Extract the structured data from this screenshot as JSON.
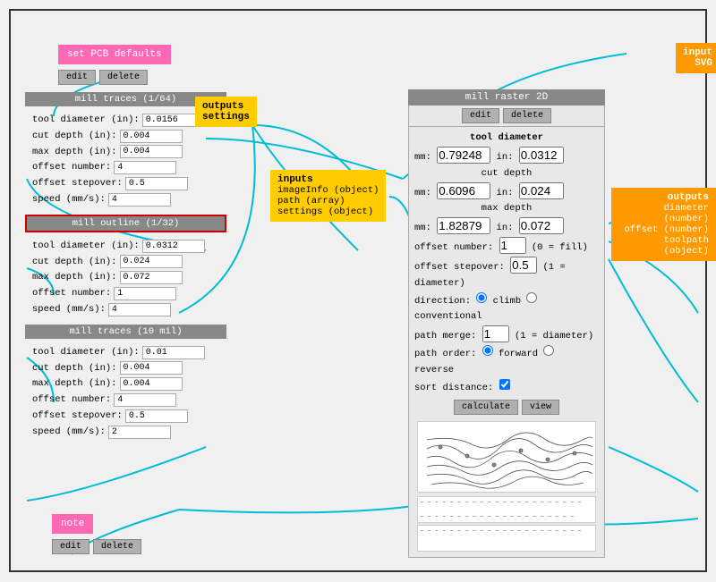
{
  "frame": {
    "border_color": "#333"
  },
  "nodes": {
    "set_pcb_defaults": {
      "label": "set PCB defaults"
    },
    "edit_delete_1": {
      "edit": "edit",
      "delete": "delete"
    },
    "mill_traces_164": {
      "title": "mill traces (1/64)",
      "tool_diameter_label": "tool diameter (in):",
      "tool_diameter_val": "0.0156",
      "cut_depth_label": "cut depth (in):",
      "cut_depth_val": "0.004",
      "max_depth_label": "max depth (in):",
      "max_depth_val": "0.004",
      "offset_number_label": "offset number:",
      "offset_number_val": "4",
      "offset_stepover_label": "offset stepover:",
      "offset_stepover_val": "0.5",
      "speed_label": "speed (mm/s):",
      "speed_val": "4"
    },
    "mill_outline_132": {
      "title": "mill outline (1/32)",
      "tool_diameter_label": "tool diameter (in):",
      "tool_diameter_val": "0.0312",
      "cut_depth_label": "cut depth (in):",
      "cut_depth_val": "0.024",
      "max_depth_label": "max depth (in):",
      "max_depth_val": "0.072",
      "offset_number_label": "offset number:",
      "offset_number_val": "1",
      "speed_label": "speed (mm/s):",
      "speed_val": "4"
    },
    "mill_traces_10mil": {
      "title": "mill traces (10 mil)",
      "tool_diameter_label": "tool diameter (in):",
      "tool_diameter_val": "0.01",
      "cut_depth_label": "cut depth (in):",
      "cut_depth_val": "0.004",
      "max_depth_label": "max depth (in):",
      "max_depth_val": "0.004",
      "offset_number_label": "offset number:",
      "offset_number_val": "4",
      "offset_stepover_label": "offset stepover:",
      "offset_stepover_val": "0.5",
      "speed_label": "speed (mm/s):",
      "speed_val": "2"
    },
    "outputs_settings": {
      "label": "outputs\nsettings"
    },
    "inputs_node": {
      "label": "inputs",
      "items": [
        "imageInfo (object)",
        "path (array)",
        "settings (object)"
      ]
    },
    "mill_raster_2d": {
      "title": "mill raster 2D",
      "edit": "edit",
      "delete": "delete",
      "tool_diameter_label": "tool diameter",
      "mm_label": "mm:",
      "mm_val": "0.79248",
      "in_label": "in:",
      "in_val": "0.0312",
      "cut_depth_label": "cut depth",
      "cut_mm_label": "mm:",
      "cut_mm_val": "0.6096",
      "cut_in_label": "in:",
      "cut_in_val": "0.024",
      "max_depth_label": "max depth",
      "max_mm_label": "mm:",
      "max_mm_val": "1.82879",
      "max_in_label": "in:",
      "max_in_val": "0.072",
      "offset_number_label": "offset number:",
      "offset_number_val": "1",
      "offset_fill_label": "(0 = fill)",
      "offset_stepover_label": "offset stepover:",
      "offset_stepover_val": "0.5",
      "offset_diam_label": "(1 = diameter)",
      "direction_label": "direction:",
      "direction_climb": "climb",
      "direction_conventional": "conventional",
      "path_merge_label": "path merge:",
      "path_merge_val": "1",
      "path_merge_hint": "(1 = diameter)",
      "path_order_label": "path order:",
      "path_forward": "forward",
      "path_reverse": "reverse",
      "sort_distance_label": "sort distance:",
      "calculate_btn": "calculate",
      "view_btn": "view"
    },
    "outputs_node": {
      "label": "outputs",
      "items": [
        "diameter (number)",
        "offset (number)",
        "toolpath (object)"
      ]
    },
    "input_svg": {
      "label": "input\nSVG"
    },
    "note_node": {
      "label": "note"
    },
    "edit_delete_note": {
      "edit": "edit",
      "delete": "delete"
    }
  }
}
